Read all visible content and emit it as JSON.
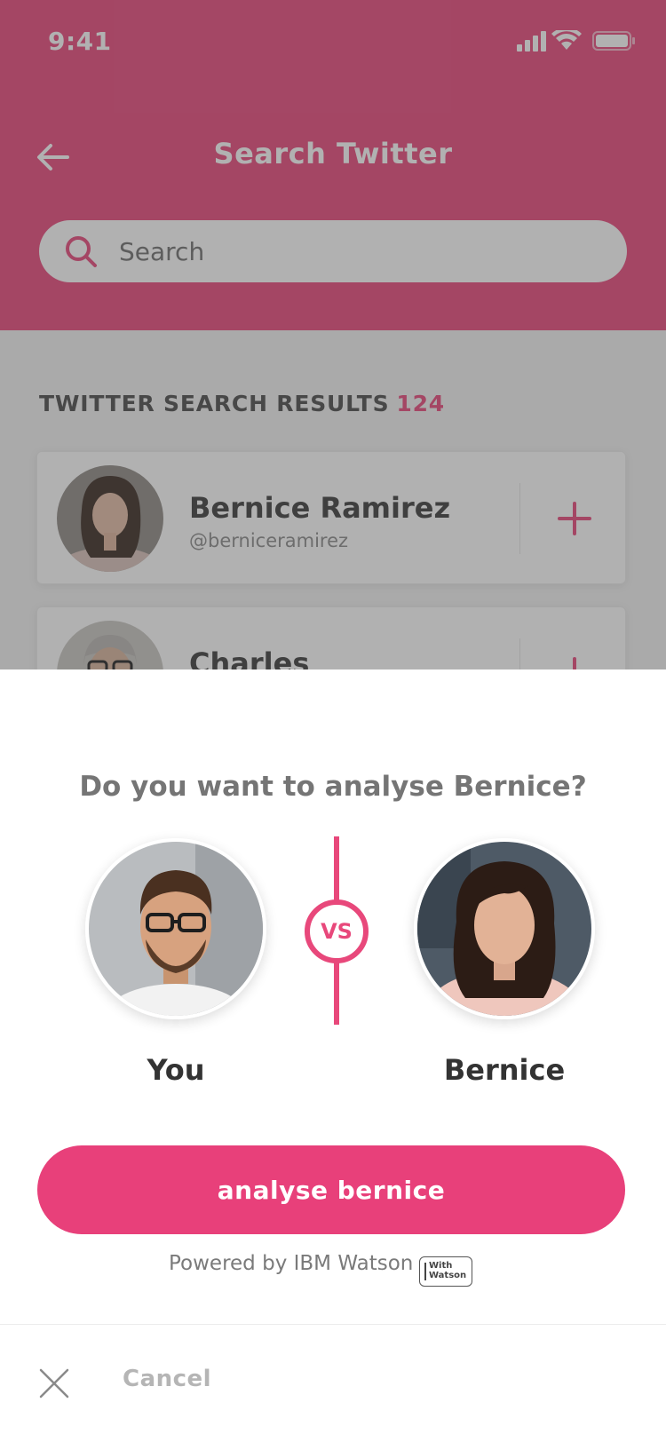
{
  "status_bar": {
    "time": "9:41",
    "icons": [
      "signal-icon",
      "wifi-icon",
      "battery-icon"
    ]
  },
  "header": {
    "title": "Search Twitter",
    "back_icon": "back-arrow-icon",
    "color": "#e8487b"
  },
  "search": {
    "placeholder": "Search",
    "value": "",
    "icon": "search-icon"
  },
  "results": {
    "heading": "TWITTER SEARCH RESULTS",
    "count": "124",
    "items": [
      {
        "name": "Bernice Ramirez",
        "handle": "@berniceramirez",
        "action_icon": "plus-icon"
      },
      {
        "name": "Charles",
        "handle": "",
        "action_icon": "plus-icon"
      }
    ]
  },
  "dialog": {
    "question": "Do you want to analyse Bernice?",
    "you_label": "You",
    "vs_label": "VS",
    "other_label": "Bernice",
    "button_label": "analyse bernice",
    "powered_by": "Powered by IBM Watson",
    "badge": {
      "line1": "With",
      "line2": "Watson"
    },
    "cancel_label": "Cancel",
    "cancel_icon": "close-icon",
    "accent": "#e8407a"
  }
}
